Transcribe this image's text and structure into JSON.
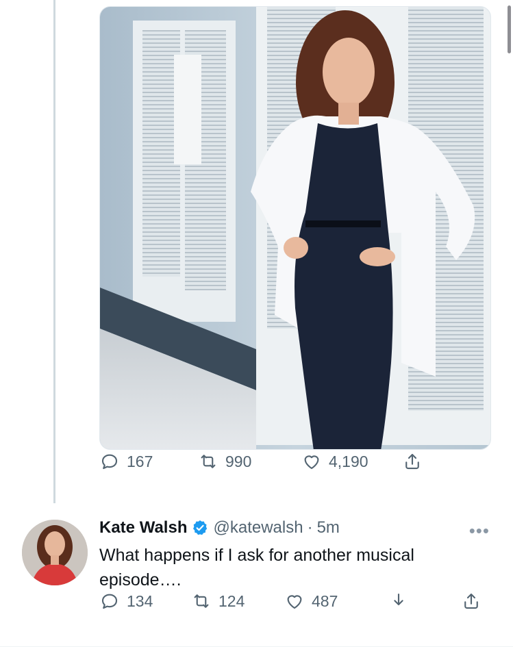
{
  "tweet1": {
    "replies": "167",
    "retweets": "990",
    "likes": "4,190"
  },
  "tweet2": {
    "author_name": "Kate Walsh",
    "handle": "@katewalsh",
    "separator": "·",
    "time": "5m",
    "text": "What happens if I ask for another musical episode….",
    "replies": "134",
    "retweets": "124",
    "likes": "487"
  },
  "icons": {
    "reply": "reply-icon",
    "retweet": "retweet-icon",
    "like": "heart-icon",
    "share": "share-icon",
    "download": "download-icon",
    "verified": "verified-badge-icon",
    "more": "more-icon"
  },
  "colors": {
    "text_primary": "#0f1419",
    "text_secondary": "#536471",
    "verified_blue": "#1d9bf0",
    "thread_line": "#cfd9de"
  }
}
